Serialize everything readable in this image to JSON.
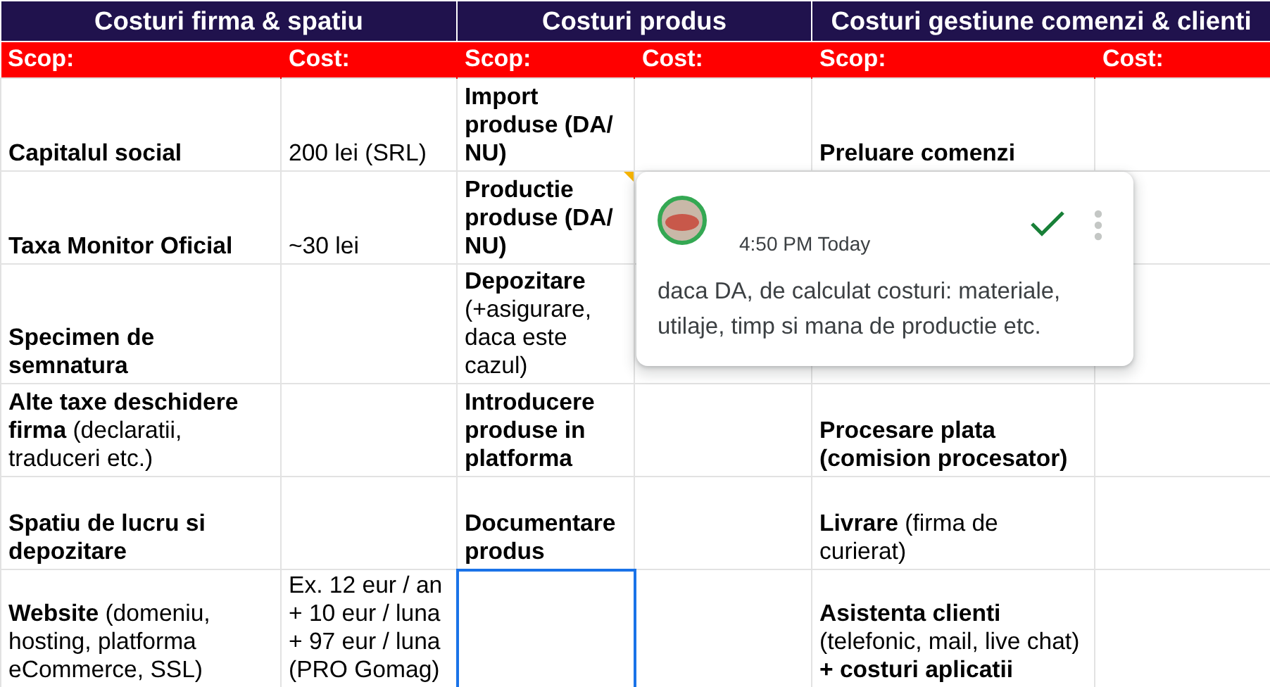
{
  "groups": [
    "Costuri firma & spatiu",
    "Costuri produs",
    "Costuri gestiune comenzi & clienti"
  ],
  "columns": [
    "Scop:",
    "Cost:",
    "Scop:",
    "Cost:",
    "Scop:",
    "Cost:"
  ],
  "rows": [
    {
      "cells": [
        {
          "text": "Capitalul social",
          "bold": true,
          "selected": false
        },
        {
          "text": "200 lei (SRL)",
          "bold": false,
          "selected": false
        },
        {
          "text": "Import produse (DA/ NU)",
          "bold": true,
          "selected": false
        },
        {
          "selected": false
        },
        {
          "text": "Preluare comenzi",
          "bold": true,
          "selected": false
        },
        {
          "selected": false
        }
      ]
    },
    {
      "cells": [
        {
          "text": "Taxa Monitor Oficial",
          "bold": true,
          "selected": false
        },
        {
          "text": "~30 lei",
          "bold": false,
          "selected": false
        },
        {
          "text": "Productie produse (DA/ NU)",
          "bold": true,
          "selected": false,
          "has_comment": true
        },
        {},
        {},
        {
          "selected": false
        }
      ]
    },
    {
      "cells": [
        {
          "text": "Specimen de semnatura",
          "bold": true,
          "selected": false
        },
        {
          "selected": false
        },
        {
          "text": "**Depozitare** (+asigurare, daca este cazul)",
          "bold": false,
          "selected": false
        },
        {},
        {},
        {
          "selected": false
        }
      ]
    },
    {
      "cells": [
        {
          "text": "**Alte taxe deschidere firma** (declaratii, traduceri etc.)",
          "bold": false,
          "selected": false
        },
        {
          "selected": false
        },
        {
          "text": "Introducere produse in platforma",
          "bold": true,
          "selected": false
        },
        {
          "selected": false
        },
        {
          "text": "Procesare plata (comision procesator)",
          "bold": true,
          "selected": false
        },
        {
          "selected": false
        }
      ]
    },
    {
      "cells": [
        {
          "text": "Spatiu de lucru si depozitare",
          "bold": true,
          "selected": false
        },
        {
          "selected": false
        },
        {
          "text": "Documentare produs",
          "bold": true,
          "selected": false
        },
        {
          "selected": false
        },
        {
          "text": "**Livrare** (firma de curierat)",
          "bold": false,
          "selected": false
        },
        {
          "selected": false
        }
      ]
    },
    {
      "cells": [
        {
          "text": "**Website** (domeniu, hosting, platforma eCommerce, SSL)",
          "bold": false,
          "selected": false
        },
        {
          "text": "Ex. 12 eur / an + 10 eur / luna + 97 eur / luna (PRO Gomag)",
          "bold": false,
          "selected": false
        },
        {
          "selected": true
        },
        {
          "selected": false
        },
        {
          "text": "**Asistenta clienti** (telefonic, mail, live chat) **+ costuri aplicatii**",
          "bold": false,
          "selected": false
        },
        {
          "selected": false
        }
      ]
    }
  ],
  "comment": {
    "time": "4:50 PM Today",
    "resolved": true,
    "text": "daca DA, de calculat costuri: materiale, utilaje, timp si mana de productie etc."
  }
}
